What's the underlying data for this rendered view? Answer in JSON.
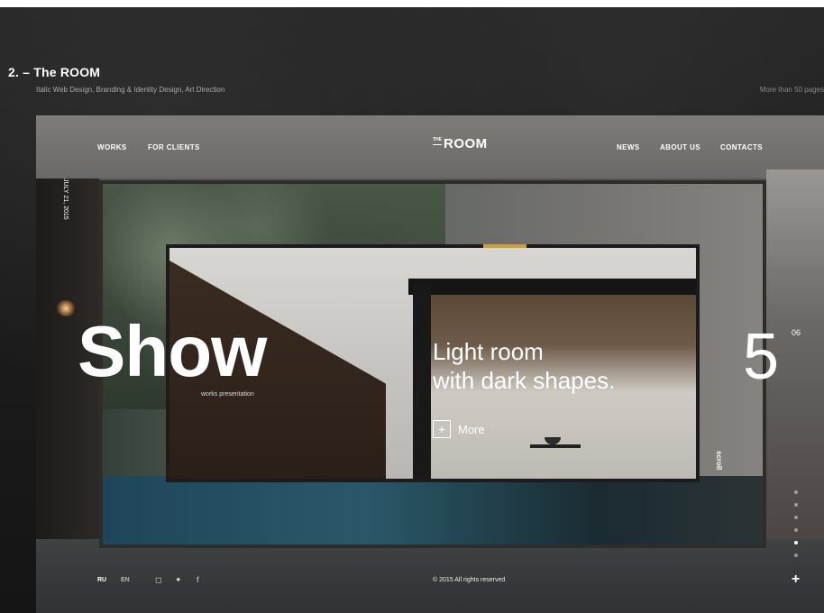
{
  "project": {
    "title": "2. – The ROOM",
    "subtitle": "Italic Web Design, Branding & Identity Design, Art Direction",
    "note": "More than 50 pages"
  },
  "nav": {
    "left": [
      "WORKS",
      "FOR CLIENTS"
    ],
    "right": [
      "NEWS",
      "ABOUT US",
      "CONTACTS"
    ],
    "logo_the": "THE",
    "logo_room": "ROOM"
  },
  "side_date": "JULY 21, 2015",
  "hero": {
    "word": "Show",
    "word_sub": "works presentation",
    "headline_line1": "Light room",
    "headline_line2": "with dark shapes.",
    "more_icon": "+",
    "more_label": "More",
    "count": "5",
    "total": "06",
    "scroll": "scroll"
  },
  "dots": {
    "count": 6,
    "active_index": 4
  },
  "footer": {
    "langs": [
      "RU",
      "EN"
    ],
    "social_icons": [
      "instagram-icon",
      "twitter-icon",
      "facebook-icon"
    ],
    "social_glyphs": [
      "◻",
      "✦",
      "f"
    ],
    "copyright": "© 2015 All rights reserved",
    "plus": "+"
  },
  "colors": {
    "accent": "#c9a33a",
    "text": "#ffffff",
    "background": "#1b1b1b"
  }
}
